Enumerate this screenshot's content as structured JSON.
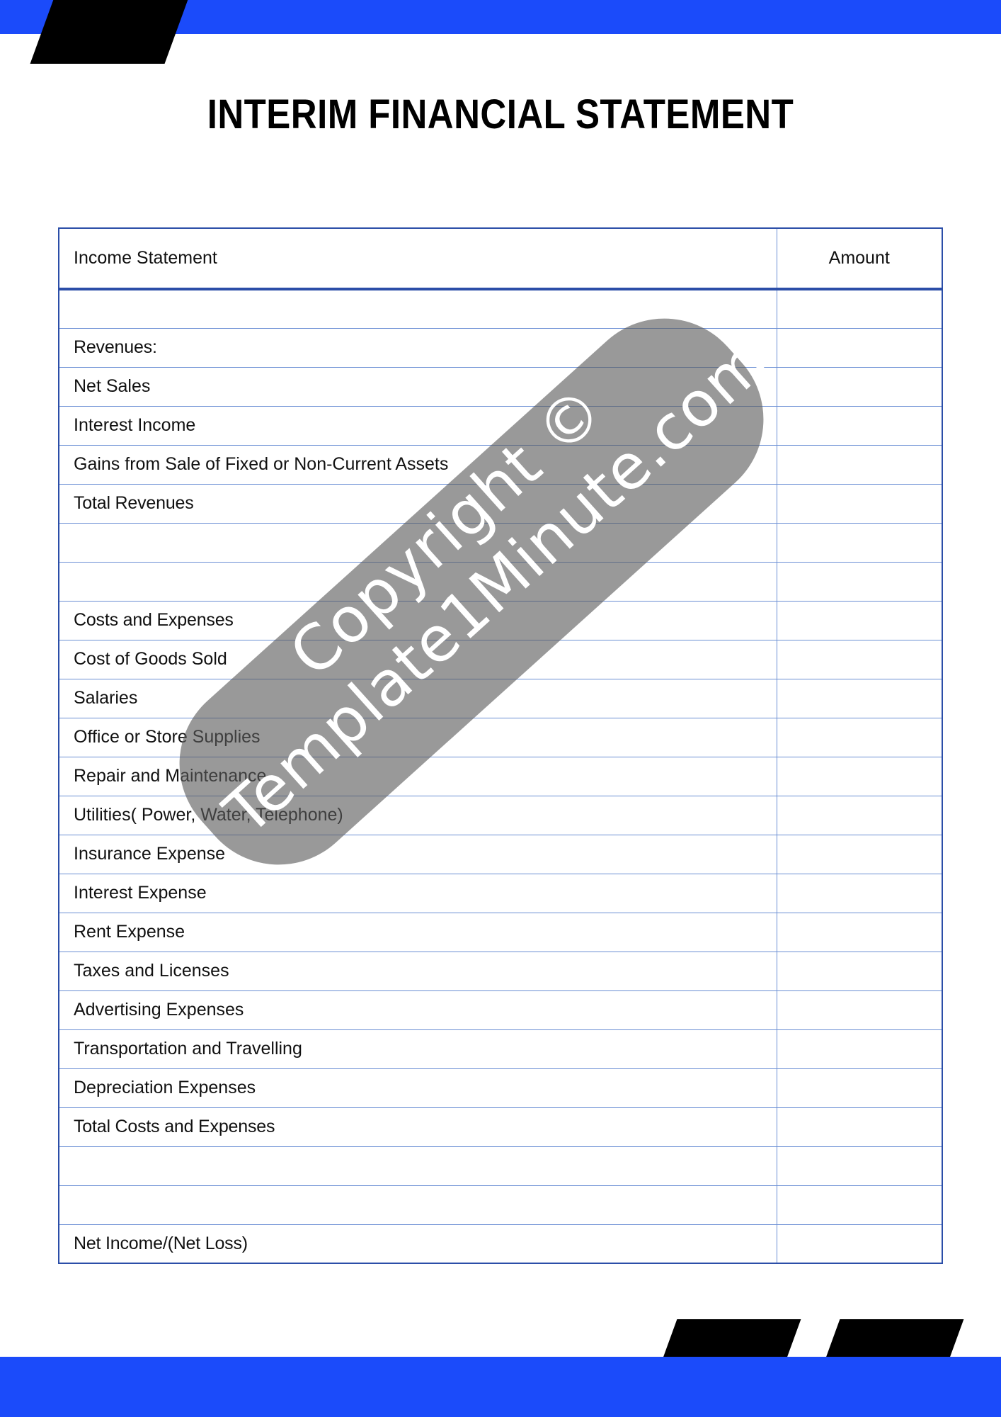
{
  "document": {
    "title": "INTERIM FINANCIAL STATEMENT"
  },
  "theme": {
    "accent_blue": "#1B4BFA",
    "table_border_blue": "#2b4ea8",
    "grid_blue": "#6b8fd4",
    "decor_black": "#000000"
  },
  "table": {
    "header": {
      "label": "Income Statement",
      "amount": "Amount"
    },
    "rows": [
      {
        "label": "",
        "amount": "",
        "style": "blank"
      },
      {
        "label": "Revenues:",
        "amount": "",
        "style": "bold"
      },
      {
        "label": "Net Sales",
        "amount": "",
        "style": "normal"
      },
      {
        "label": "Interest Income",
        "amount": "",
        "style": "normal"
      },
      {
        "label": "Gains from Sale of Fixed or Non-Current Assets",
        "amount": "",
        "style": "normal"
      },
      {
        "label": "Total Revenues",
        "amount": "",
        "style": "bold"
      },
      {
        "label": "",
        "amount": "",
        "style": "blank"
      },
      {
        "label": "",
        "amount": "",
        "style": "blank"
      },
      {
        "label": "Costs and Expenses",
        "amount": "",
        "style": "bold"
      },
      {
        "label": "Cost of Goods Sold",
        "amount": "",
        "style": "normal"
      },
      {
        "label": "Salaries",
        "amount": "",
        "style": "normal"
      },
      {
        "label": "Office or Store Supplies",
        "amount": "",
        "style": "normal"
      },
      {
        "label": "Repair and Maintenance",
        "amount": "",
        "style": "normal"
      },
      {
        "label": "Utilities( Power, Water, Telephone)",
        "amount": "",
        "style": "normal"
      },
      {
        "label": "Insurance Expense",
        "amount": "",
        "style": "normal"
      },
      {
        "label": "Interest Expense",
        "amount": "",
        "style": "normal"
      },
      {
        "label": "Rent Expense",
        "amount": "",
        "style": "normal"
      },
      {
        "label": "Taxes and Licenses",
        "amount": "",
        "style": "normal"
      },
      {
        "label": "Advertising Expenses",
        "amount": "",
        "style": "normal"
      },
      {
        "label": "Transportation and Travelling",
        "amount": "",
        "style": "normal"
      },
      {
        "label": "Depreciation Expenses",
        "amount": "",
        "style": "normal"
      },
      {
        "label": "Total Costs and Expenses",
        "amount": "",
        "style": "bold"
      },
      {
        "label": "",
        "amount": "",
        "style": "blank"
      },
      {
        "label": "",
        "amount": "",
        "style": "blank"
      },
      {
        "label": "Net Income/(Net Loss)",
        "amount": "",
        "style": "bold"
      }
    ]
  },
  "watermark": {
    "line1": "Copyright ©",
    "line2": "Template1Minute.com"
  }
}
